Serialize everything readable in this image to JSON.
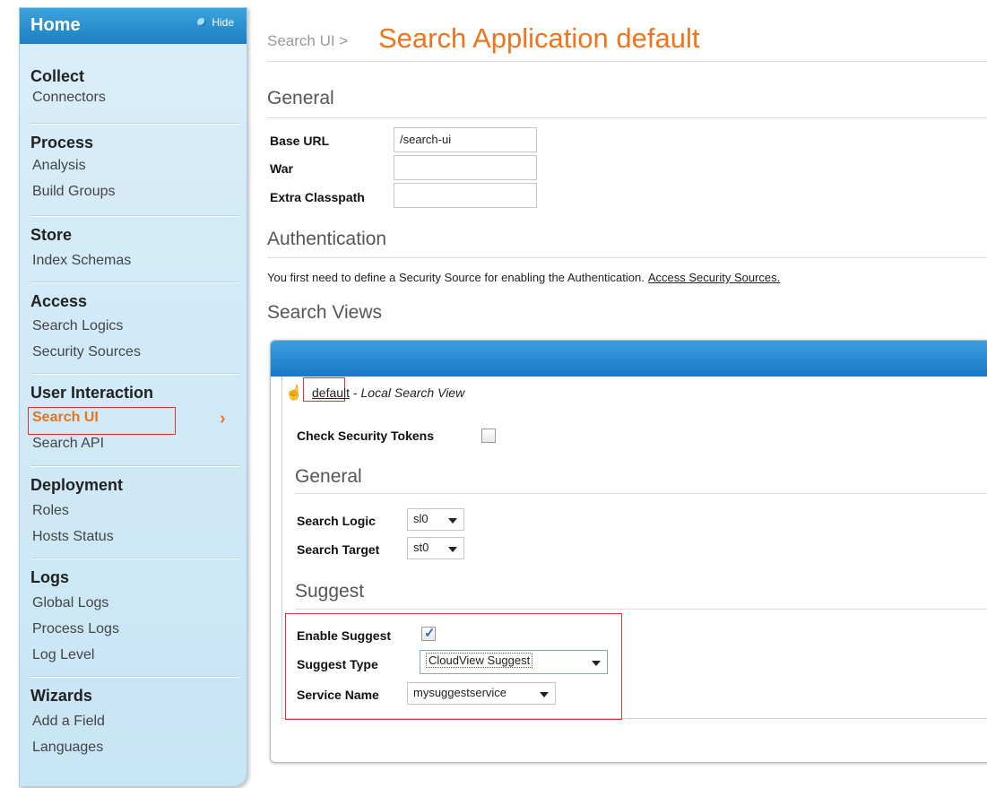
{
  "sidebar": {
    "home_label": "Home",
    "hide_label": "Hide",
    "sections": [
      {
        "title": "Collect",
        "items": [
          "Connectors"
        ]
      },
      {
        "title": "Process",
        "items": [
          "Analysis",
          "Build Groups"
        ]
      },
      {
        "title": "Store",
        "items": [
          "Index Schemas"
        ]
      },
      {
        "title": "Access",
        "items": [
          "Search Logics",
          "Security Sources"
        ]
      },
      {
        "title": "User Interaction",
        "items": [
          "Search UI",
          "Search API"
        ]
      },
      {
        "title": "Deployment",
        "items": [
          "Roles",
          "Hosts Status"
        ]
      },
      {
        "title": "Logs",
        "items": [
          "Global Logs",
          "Process Logs",
          "Log Level"
        ]
      },
      {
        "title": "Wizards",
        "items": [
          "Add a Field",
          "Languages"
        ]
      }
    ],
    "active_item": "Search UI",
    "active_chevron": "›"
  },
  "header": {
    "breadcrumb": "Search UI >",
    "title": "Search Application default"
  },
  "general": {
    "title": "General",
    "fields": [
      {
        "label": "Base URL",
        "value": "/search-ui"
      },
      {
        "label": "War",
        "value": ""
      },
      {
        "label": "Extra Classpath",
        "value": ""
      }
    ]
  },
  "authentication": {
    "title": "Authentication",
    "note": "You first need to define a Security Source for enabling the Authentication.",
    "link": "Access Security Sources."
  },
  "search_views": {
    "title": "Search Views",
    "hand_icon": "hand-pointer-icon",
    "view_name": "default",
    "view_separator": " - ",
    "view_desc": "Local Search View",
    "check_security_tokens_label": "Check Security Tokens",
    "check_security_tokens_checked": false,
    "general_title": "General",
    "search_logic_label": "Search Logic",
    "search_logic_value": "sl0",
    "search_target_label": "Search Target",
    "search_target_value": "st0",
    "suggest_title": "Suggest",
    "enable_suggest_label": "Enable Suggest",
    "enable_suggest_checked": true,
    "suggest_type_label": "Suggest Type",
    "suggest_type_value": "CloudView Suggest",
    "service_name_label": "Service Name",
    "service_name_value": "mysuggestservice"
  },
  "colors": {
    "accent_orange": "#f0741d",
    "header_blue": "#1e80c2",
    "highlight_red": "#e0312f"
  }
}
